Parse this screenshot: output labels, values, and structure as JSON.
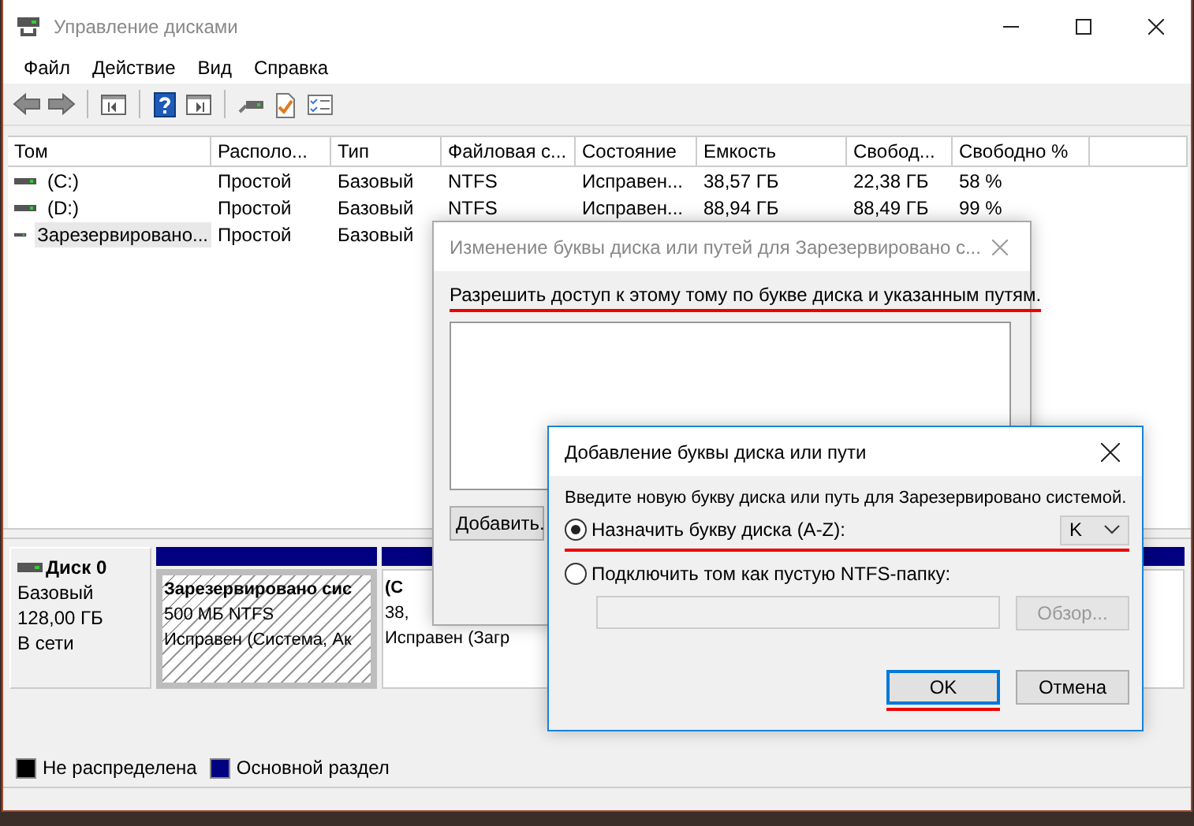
{
  "window": {
    "title": "Управление дисками"
  },
  "menu": [
    "Файл",
    "Действие",
    "Вид",
    "Справка"
  ],
  "toolbar": [
    {
      "kind": "back"
    },
    {
      "kind": "forward"
    },
    {
      "kind": "sep"
    },
    {
      "kind": "tree"
    },
    {
      "kind": "sep"
    },
    {
      "kind": "help"
    },
    {
      "kind": "panel"
    },
    {
      "kind": "sep"
    },
    {
      "kind": "connect"
    },
    {
      "kind": "check"
    },
    {
      "kind": "list"
    }
  ],
  "volumes": {
    "columns": [
      "Том",
      "Располо...",
      "Тип",
      "Файловая с...",
      "Состояние",
      "Емкость",
      "Свобод...",
      "Свободно %"
    ],
    "rows": [
      {
        "cells": [
          "(C:)",
          "Простой",
          "Базовый",
          "NTFS",
          "Исправен...",
          "38,57 ГБ",
          "22,38 ГБ",
          "58 %"
        ],
        "selected": false
      },
      {
        "cells": [
          "(D:)",
          "Простой",
          "Базовый",
          "NTFS",
          "Исправен...",
          "88,94 ГБ",
          "88,49 ГБ",
          "99 %"
        ],
        "selected": false
      },
      {
        "cells": [
          "Зарезервировано...",
          "Простой",
          "Базовый"
        ],
        "selected": true
      }
    ]
  },
  "disks": [
    {
      "name": "Диск 0",
      "type": "Базовый",
      "size": "128,00 ГБ",
      "status": "В сети",
      "partitions": [
        {
          "lines": [
            "Зарезервировано сис",
            "500 МБ NTFS",
            "Исправен (Система, Ак"
          ],
          "selected": true
        },
        {
          "lines": [
            "(C",
            "38,",
            "Исправен (Загр"
          ],
          "selected": false
        }
      ]
    }
  ],
  "legend": [
    {
      "label": "Не распределена",
      "color": "#000000"
    },
    {
      "label": "Основной раздел",
      "color": "#000080"
    }
  ],
  "path_dialog": {
    "title": "Изменение буквы диска или путей для Зарезервировано с...",
    "message": "Разрешить доступ к этому тому по букве диска и указанным путям.",
    "underlined": true,
    "button": "Добавить."
  },
  "add_dialog": {
    "title": "Добавление буквы диска или пути",
    "prompt": "Введите новую букву диска или путь для Зарезервировано системой.",
    "options": [
      {
        "label": "Назначить букву диска (A-Z):",
        "selected": true,
        "underlined": true
      },
      {
        "label": "Подключить том как пустую NTFS-папку:",
        "selected": false,
        "underlined": false
      }
    ],
    "letter": "K",
    "folder": {
      "disabled": true
    },
    "browse": {
      "label": "Обзор...",
      "disabled": true
    },
    "ok": {
      "label": "OK",
      "focused": true,
      "underlined": true
    },
    "cancel": {
      "label": "Отмена"
    }
  }
}
